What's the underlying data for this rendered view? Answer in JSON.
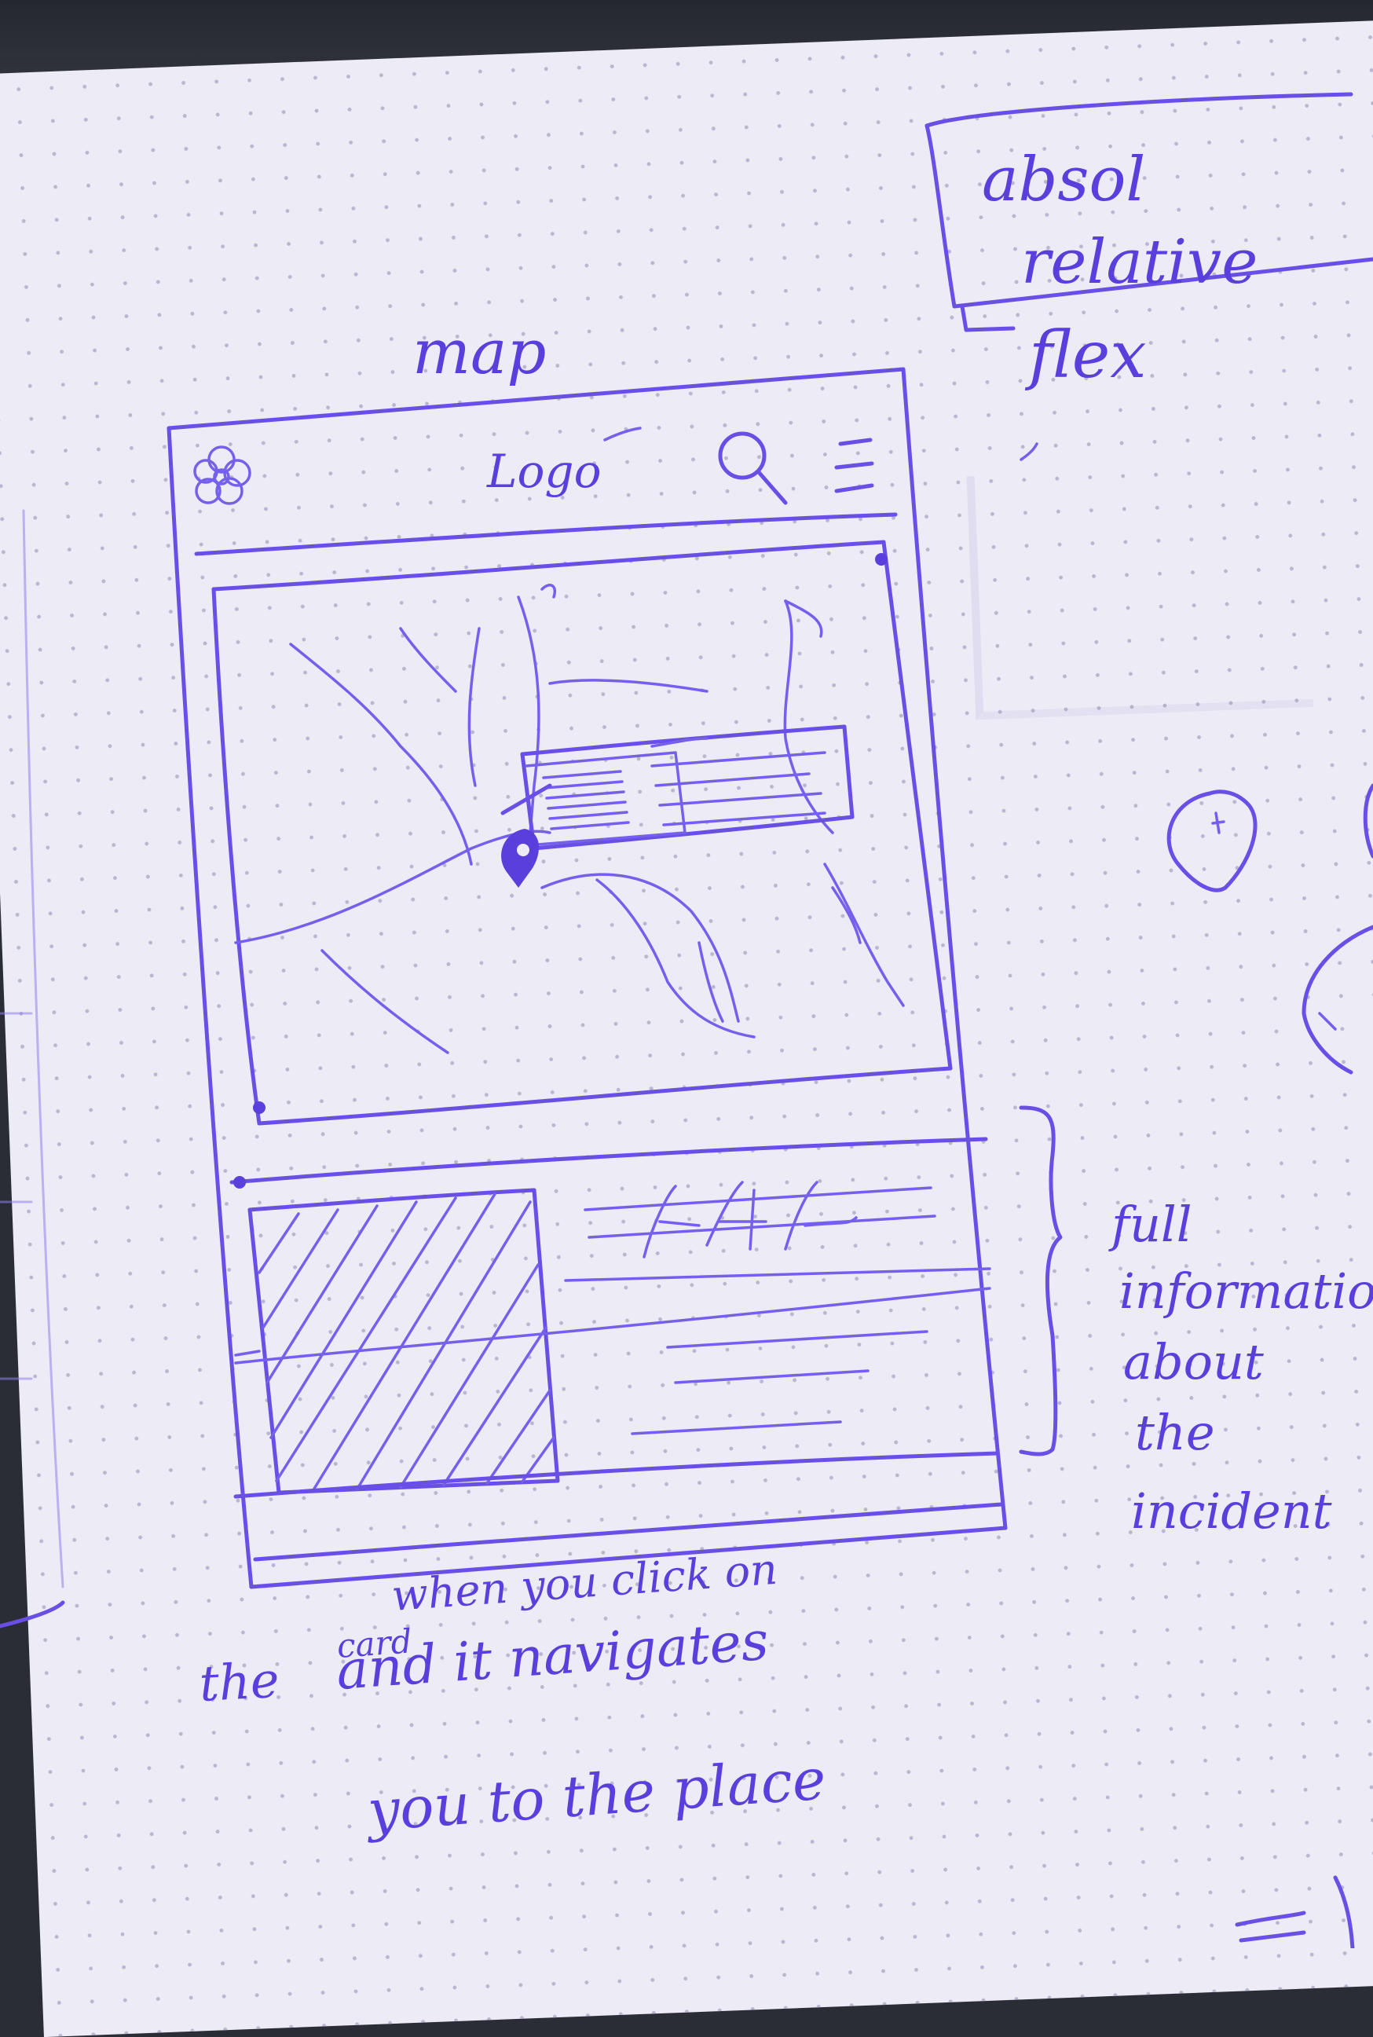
{
  "annotations": {
    "top_label": "map",
    "css_note_1": "absol",
    "css_note_2": "relative",
    "css_note_3": "flex",
    "side_note": [
      "full",
      "information",
      "about",
      "the",
      "incident"
    ],
    "bottom_note_line1_small": "when you click on",
    "bottom_note_line1_left": "the",
    "bottom_note_card_word": "card",
    "bottom_note_line1_right": "and it navigates",
    "bottom_note_line2": "you to the place"
  },
  "wireframe": {
    "header": {
      "logo_text": "Logo",
      "left_icon": "flower-logo-icon",
      "search_icon": "search-icon",
      "menu_icon": "hamburger-menu-icon"
    },
    "map_area": {
      "icon": "map-marker-icon"
    },
    "card": {
      "image_placeholder": "hatched-image-placeholder"
    }
  },
  "colors": {
    "ink": "#6a4fe6",
    "paper": "#ecebf6",
    "background": "#2b2d36"
  }
}
